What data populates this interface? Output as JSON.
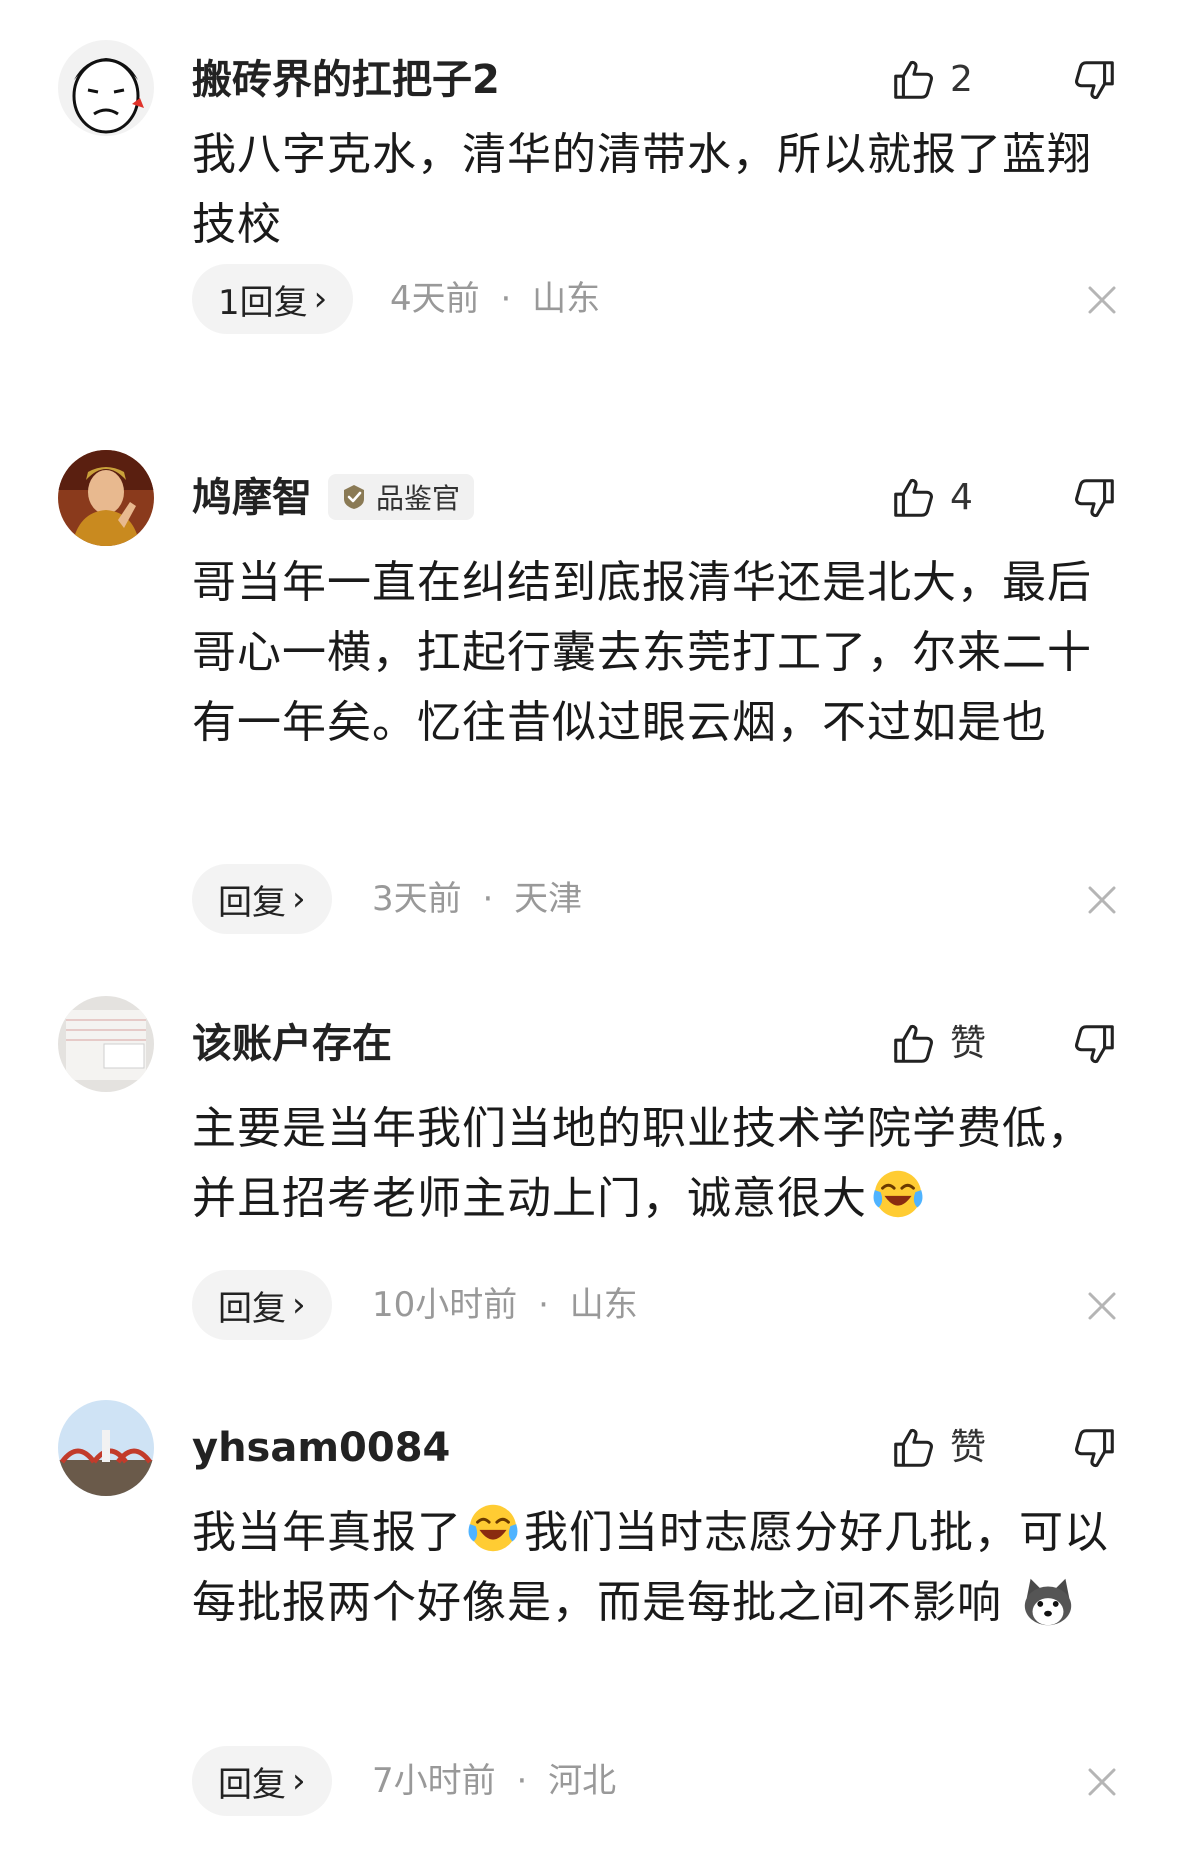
{
  "comments": [
    {
      "username": "搬砖界的扛把子2",
      "badge": "",
      "like_count": "2",
      "body": "我八字克水，清华的清带水，所以就报了蓝翔技校",
      "reply_label": "1回复",
      "time": "4天前",
      "location": "山东"
    },
    {
      "username": "鸠摩智",
      "badge": "品鉴官",
      "like_count": "4",
      "body": "哥当年一直在纠结到底报清华还是北大，最后哥心一横，扛起行囊去东莞打工了，尔来二十有一年矣。忆往昔似过眼云烟，不过如是也",
      "reply_label": "回复",
      "time": "3天前",
      "location": "天津"
    },
    {
      "username": "该账户存在",
      "badge": "",
      "like_count": "赞",
      "body": "主要是当年我们当地的职业技术学院学费低，并且招考老师主动上门，诚意很大",
      "reply_label": "回复",
      "time": "10小时前",
      "location": "山东"
    },
    {
      "username": "yhsam0084",
      "badge": "",
      "like_count": "赞",
      "body_part1": "我当年真报了",
      "body_part2": "我们当时志愿分好几批，可以每批报两个好像是，而是每批之间不影响",
      "reply_label": "回复",
      "time": "7小时前",
      "location": "河北"
    }
  ],
  "separator": "·",
  "icons": {
    "like": "thumbs-up-icon",
    "dislike": "thumbs-down-icon",
    "close": "close-icon",
    "chevron": "chevron-right-icon",
    "emoji_laugh": "laughing-crying-emoji",
    "emoji_husky": "husky-emoji",
    "badge": "verified-badge-icon"
  }
}
